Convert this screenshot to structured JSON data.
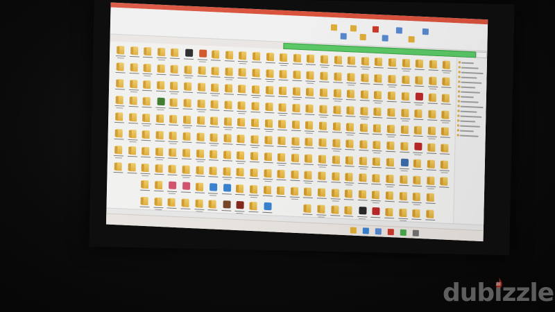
{
  "scene": {
    "description_kind": "photo-of-monitor-showing-file-explorer",
    "window": {
      "title_bar_color": "#e2553f",
      "address_bar_color": "#5fd06a",
      "ribbon_icons": [
        {
          "name": "new-folder-icon",
          "color": "#e8b43b"
        },
        {
          "name": "copy-icon",
          "color": "#5b8fd6"
        },
        {
          "name": "paste-icon",
          "color": "#e8b43b"
        },
        {
          "name": "move-icon",
          "color": "#e8b43b"
        },
        {
          "name": "delete-icon",
          "color": "#d33b2c"
        },
        {
          "name": "rename-icon",
          "color": "#5b8fd6"
        },
        {
          "name": "properties-icon",
          "color": "#5b8fd6"
        },
        {
          "name": "open-icon",
          "color": "#e8b43b"
        },
        {
          "name": "select-all-icon",
          "color": "#5b8fd6"
        }
      ]
    },
    "content": {
      "folder_color": "#e8b43b",
      "item_rows": 10,
      "items_per_row": 25,
      "special_icons": [
        {
          "name": "app-icon-dark",
          "color": "#2a2a2a"
        },
        {
          "name": "app-icon-red-orange",
          "color": "#d95a2a"
        },
        {
          "name": "app-icon-red",
          "color": "#c42a2a"
        },
        {
          "name": "app-icon-green",
          "color": "#3d7d2b"
        },
        {
          "name": "app-icon-blue-diamond",
          "color": "#3f6fb0"
        },
        {
          "name": "app-icon-pink-diamond",
          "color": "#d8556e"
        },
        {
          "name": "internet-explorer-icon",
          "color": "#3a86d8"
        },
        {
          "name": "app-icon-brown",
          "color": "#7a4a2a"
        },
        {
          "name": "app-icon-dark-red",
          "color": "#8a2a1e"
        }
      ]
    },
    "taskbar": {
      "pinned_icons": [
        {
          "name": "explorer-icon",
          "color": "#e8b43b"
        },
        {
          "name": "browser-icon",
          "color": "#3a86d8"
        },
        {
          "name": "store-icon",
          "color": "#5b8fd6"
        },
        {
          "name": "media-icon",
          "color": "#d33b2c"
        },
        {
          "name": "chat-icon",
          "color": "#4caf50"
        },
        {
          "name": "settings-icon",
          "color": "#777777"
        }
      ]
    }
  },
  "watermark": {
    "text": "dubizzle",
    "flame_color": "#e23b2e"
  }
}
